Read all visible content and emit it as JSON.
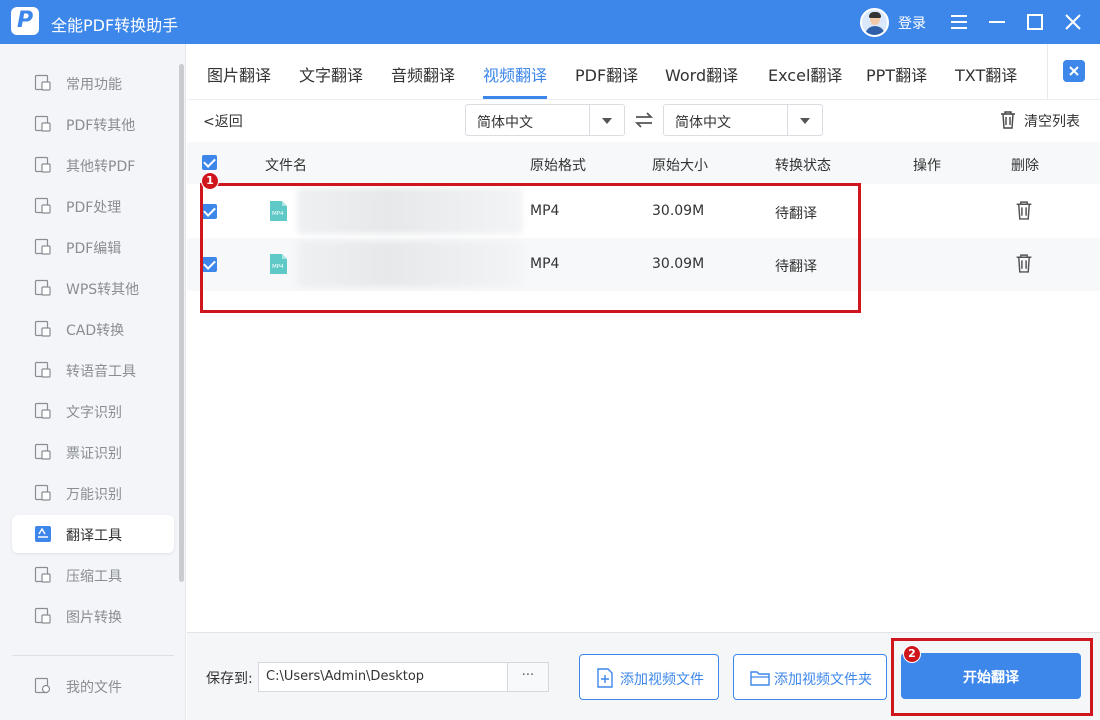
{
  "app": {
    "title": "全能PDF转换助手",
    "login_label": "登录",
    "logo_letter": "P"
  },
  "colors": {
    "accent": "#3d87ea",
    "annotation": "#d0161d"
  },
  "sidebar": {
    "items": [
      {
        "label": "常用功能",
        "icon": "star-grid-icon"
      },
      {
        "label": "PDF转其他",
        "icon": "pdf-convert-icon"
      },
      {
        "label": "其他转PDF",
        "icon": "to-pdf-icon"
      },
      {
        "label": "PDF处理",
        "icon": "pdf-process-icon"
      },
      {
        "label": "PDF编辑",
        "icon": "pdf-edit-icon"
      },
      {
        "label": "WPS转其他",
        "icon": "wps-icon"
      },
      {
        "label": "CAD转换",
        "icon": "cad-icon"
      },
      {
        "label": "转语音工具",
        "icon": "tts-icon"
      },
      {
        "label": "文字识别",
        "icon": "ocr-icon"
      },
      {
        "label": "票证识别",
        "icon": "ticket-icon"
      },
      {
        "label": "万能识别",
        "icon": "eye-icon"
      },
      {
        "label": "翻译工具",
        "icon": "translate-icon",
        "active": true
      },
      {
        "label": "压缩工具",
        "icon": "zip-icon"
      },
      {
        "label": "图片转换",
        "icon": "image-icon"
      }
    ],
    "my_files": "我的文件"
  },
  "tabs": [
    "图片翻译",
    "文字翻译",
    "音频翻译",
    "视频翻译",
    "PDF翻译",
    "Word翻译",
    "Excel翻译",
    "PPT翻译",
    "TXT翻译"
  ],
  "active_tab": "视频翻译",
  "controls": {
    "back": "返回",
    "source_lang": "简体中文",
    "target_lang": "简体中文",
    "clear_list": "清空列表"
  },
  "table": {
    "headers": {
      "file": "文件名",
      "format": "原始格式",
      "size": "原始大小",
      "status": "转换状态",
      "action": "操作",
      "delete": "删除"
    },
    "rows": [
      {
        "format": "MP4",
        "size": "30.09M",
        "status": "待翻译",
        "icon_text": "MP4"
      },
      {
        "format": "MP4",
        "size": "30.09M",
        "status": "待翻译",
        "icon_text": "MP4"
      }
    ]
  },
  "annotations": {
    "one": "1",
    "two": "2"
  },
  "bottom": {
    "save_to": "保存到:",
    "path": "C:\\Users\\Admin\\Desktop",
    "browse": "···",
    "add_file": "添加视频文件",
    "add_folder": "添加视频文件夹",
    "start": "开始翻译"
  }
}
